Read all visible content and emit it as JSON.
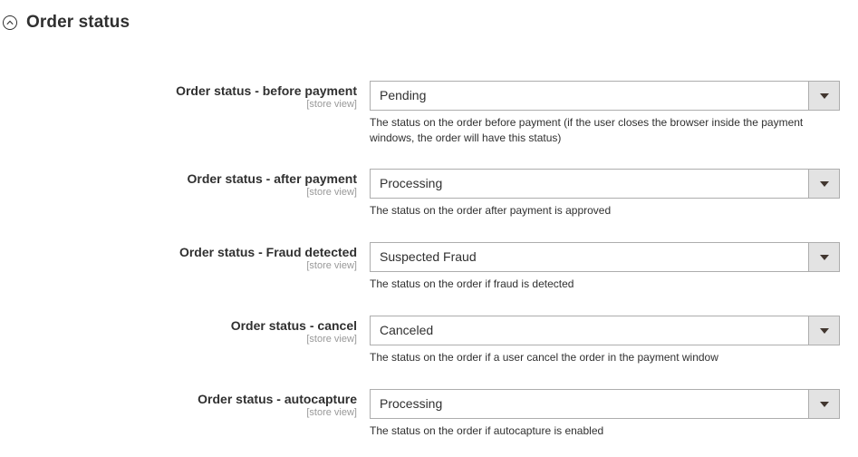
{
  "section": {
    "title": "Order status",
    "icon": "chevron-up-circle-icon"
  },
  "fields": [
    {
      "label": "Order status - before payment",
      "scope": "[store view]",
      "value": "Pending",
      "note": "The status on the order before payment (if the user closes the browser inside the payment windows, the order will have this status)"
    },
    {
      "label": "Order status - after payment",
      "scope": "[store view]",
      "value": "Processing",
      "note": "The status on the order after payment is approved"
    },
    {
      "label": "Order status - Fraud detected",
      "scope": "[store view]",
      "value": "Suspected Fraud",
      "note": "The status on the order if fraud is detected"
    },
    {
      "label": "Order status - cancel",
      "scope": "[store view]",
      "value": "Canceled",
      "note": "The status on the order if a user cancel the order in the payment window"
    },
    {
      "label": "Order status - autocapture",
      "scope": "[store view]",
      "value": "Processing",
      "note": "The status on the order if autocapture is enabled"
    }
  ],
  "colors": {
    "text": "#303030",
    "scope": "#999999",
    "border": "#adadad",
    "arrow_bg": "#e3e3e3"
  }
}
